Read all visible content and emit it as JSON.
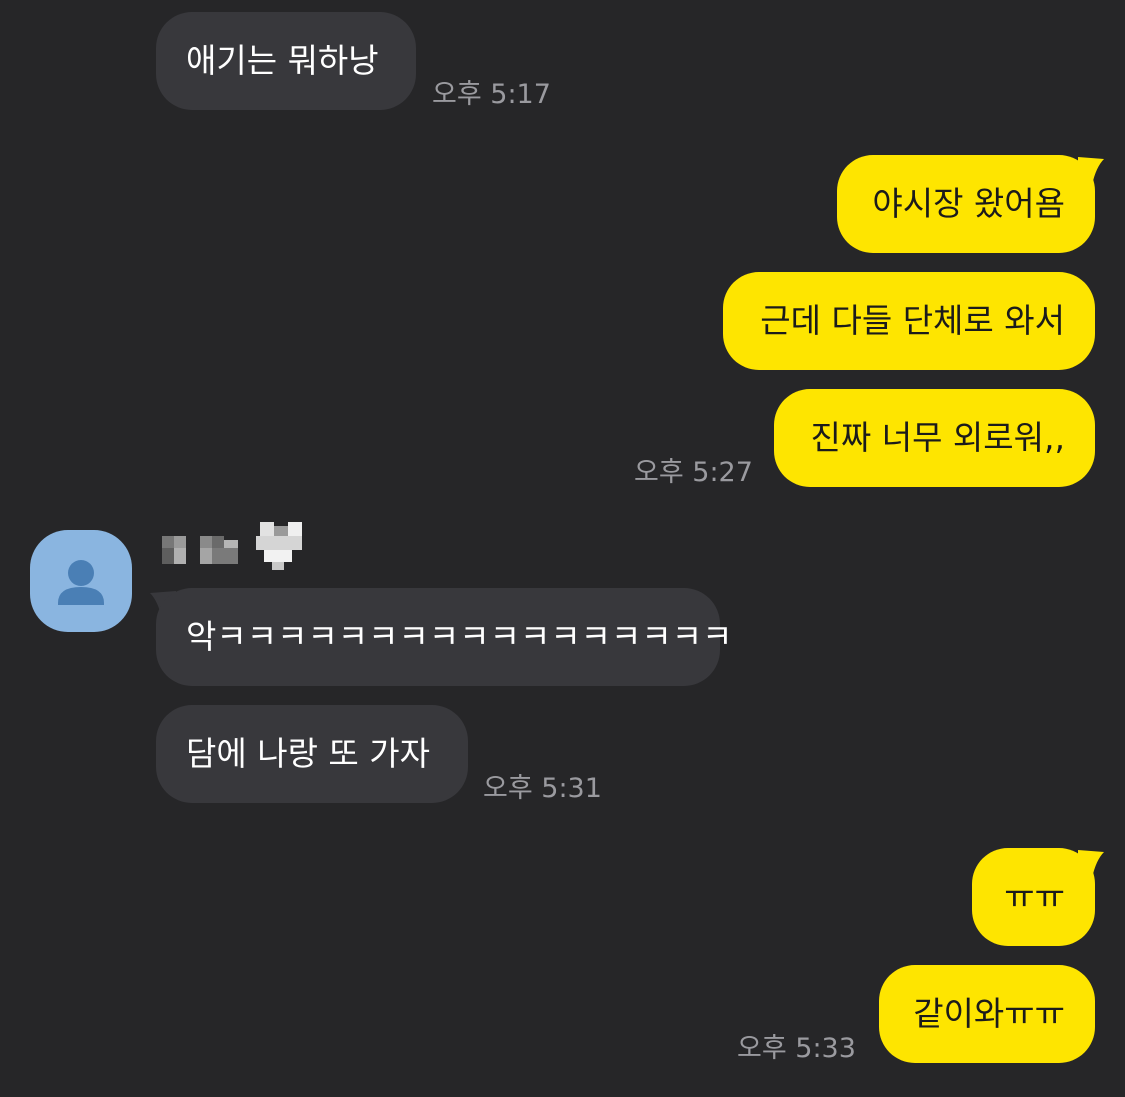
{
  "colors": {
    "background": "#262628",
    "incoming_bubble": "#38383c",
    "outgoing_bubble": "#fee500",
    "timestamp": "#9a9a9f",
    "avatar": "#8ab5e0"
  },
  "messages": [
    {
      "side": "in",
      "text": "애기는 뭐하낭"
    },
    {
      "side": "out",
      "text": "야시장 왔어욤"
    },
    {
      "side": "out",
      "text": "근데 다들 단체로 와서"
    },
    {
      "side": "out",
      "text": "진짜 너무 외로워,,"
    },
    {
      "side": "in",
      "text": "악ㅋㅋㅋㅋㅋㅋㅋㅋㅋㅋㅋㅋㅋㅋㅋㅋㅋ"
    },
    {
      "side": "in",
      "text": "담에 나랑 또 가자"
    },
    {
      "side": "out",
      "text": "ㅠㅠ"
    },
    {
      "side": "out",
      "text": "같이와ㅠㅠ"
    }
  ],
  "timestamps": [
    "오후 5:17",
    "오후 5:27",
    "오후 5:31",
    "오후 5:33"
  ],
  "sender": {
    "avatar_icon": "default-person-icon",
    "name_pixelated": true
  }
}
